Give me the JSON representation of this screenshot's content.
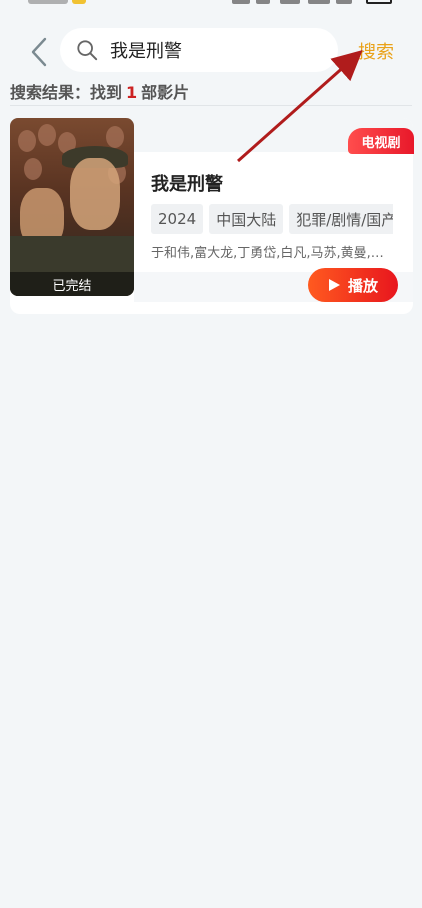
{
  "header": {
    "search_value": "我是刑警",
    "search_button_label": "搜索"
  },
  "results": {
    "summary_prefix": "搜索结果：找到",
    "count": "1",
    "summary_suffix": "部影片"
  },
  "movie": {
    "category_badge": "电视剧",
    "title": "我是刑警",
    "status_label": "已完结",
    "tags": [
      "2024",
      "中国大陆",
      "犯罪/剧情/国产"
    ],
    "cast": "于和伟,富大龙,丁勇岱,白凡,马苏,黄曼,…",
    "play_label": "播放"
  },
  "colors": {
    "accent_orange": "#e9a21a",
    "badge_red": "#e8182a",
    "play_gradient_start": "#ff5a1f",
    "play_gradient_end": "#e8161e",
    "count_red": "#cc2222",
    "annotation_arrow": "#b01c1c"
  },
  "icons": {
    "back": "chevron-left-icon",
    "search": "search-icon",
    "play": "play-icon"
  }
}
